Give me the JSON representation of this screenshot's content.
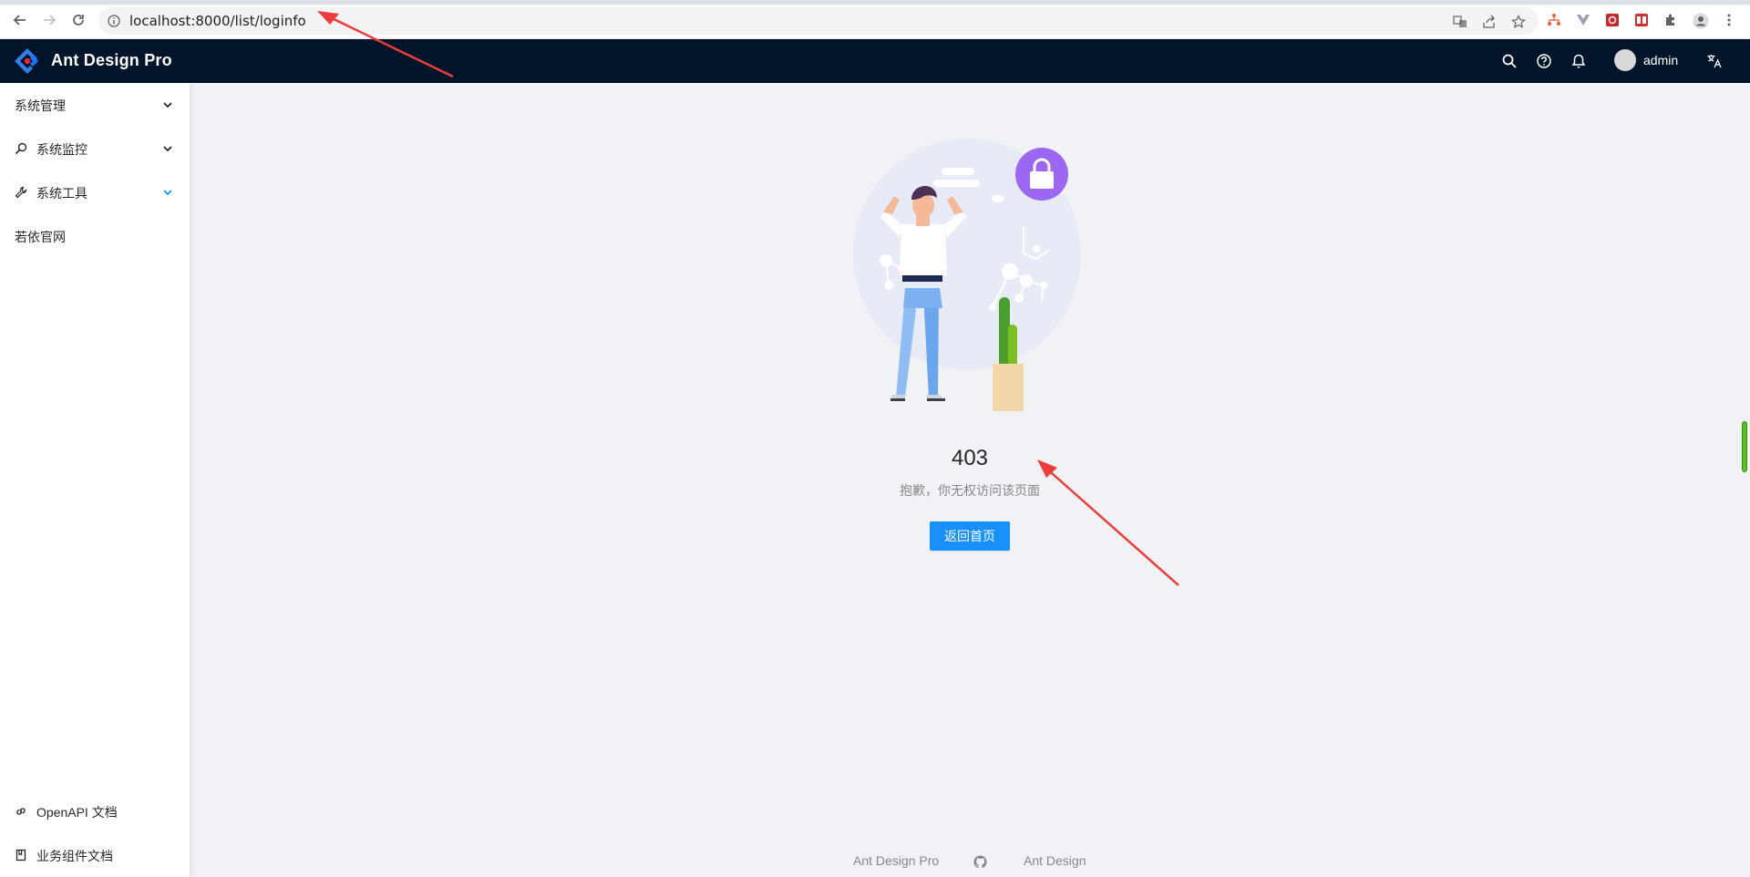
{
  "browser": {
    "url": "localhost:8000/list/loginfo"
  },
  "header": {
    "app_title": "Ant Design Pro",
    "username": "admin"
  },
  "sidebar": {
    "items": [
      {
        "label": "系统管理",
        "icon": "none",
        "has_children": true
      },
      {
        "label": "系统监控",
        "icon": "search-icon",
        "has_children": true
      },
      {
        "label": "系统工具",
        "icon": "tool-icon",
        "has_children": true,
        "active": true
      },
      {
        "label": "若依官网",
        "icon": "none",
        "has_children": false
      }
    ],
    "bottom_links": [
      {
        "label": "OpenAPI 文档",
        "icon": "link-icon"
      },
      {
        "label": "业务组件文档",
        "icon": "book-icon"
      }
    ]
  },
  "result": {
    "code": "403",
    "message": "抱歉，你无权访问该页面",
    "button_label": "返回首页"
  },
  "footer": {
    "left_link": "Ant Design Pro",
    "right_link": "Ant Design"
  },
  "colors": {
    "header_bg": "#001529",
    "primary": "#1890ff",
    "content_bg": "#f0f2f5",
    "lock_circle": "#9c67f2"
  }
}
